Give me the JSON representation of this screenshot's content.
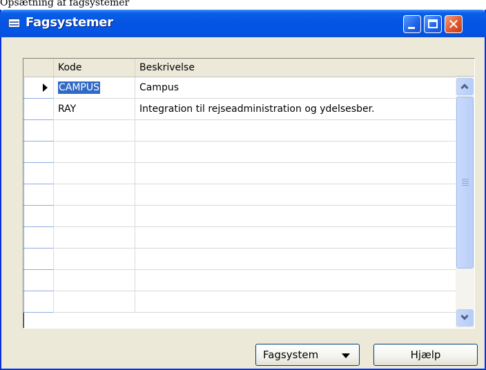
{
  "top_caption": "Opsætning af fagsystemer",
  "window": {
    "title": "Fagsystemer",
    "controls": [
      "minimize",
      "maximize",
      "close"
    ]
  },
  "grid": {
    "columns": [
      "Kode",
      "Beskrivelse"
    ],
    "rows": [
      {
        "kode": "CAMPUS",
        "beskrivelse": "Campus"
      },
      {
        "kode": "RAY",
        "beskrivelse": "Integration til rejseadministration og ydelsesber."
      },
      {
        "kode": "",
        "beskrivelse": ""
      },
      {
        "kode": "",
        "beskrivelse": ""
      },
      {
        "kode": "",
        "beskrivelse": ""
      },
      {
        "kode": "",
        "beskrivelse": ""
      },
      {
        "kode": "",
        "beskrivelse": ""
      },
      {
        "kode": "",
        "beskrivelse": ""
      },
      {
        "kode": "",
        "beskrivelse": ""
      },
      {
        "kode": "",
        "beskrivelse": ""
      },
      {
        "kode": "",
        "beskrivelse": ""
      }
    ],
    "selected_row": 0
  },
  "buttons": {
    "fagsystem": "Fagsystem",
    "help": "Hjælp"
  },
  "colors": {
    "titlebar": "#0554e3",
    "selection": "#316ac5",
    "window_bg": "#ece9d8"
  }
}
